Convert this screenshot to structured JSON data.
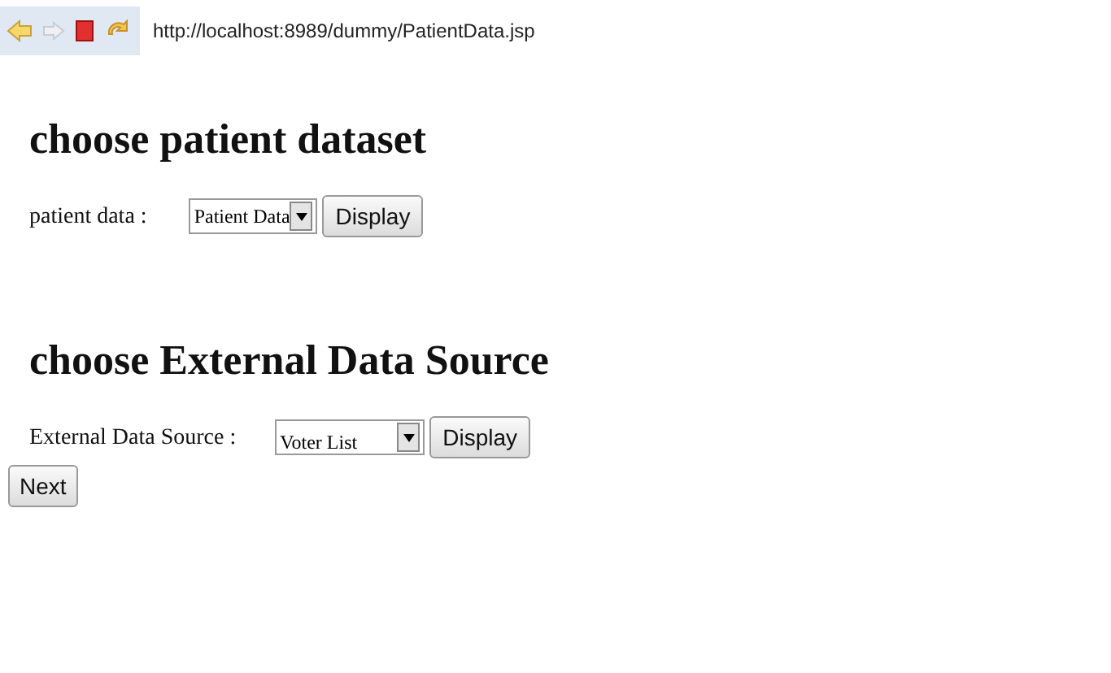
{
  "browser": {
    "address": "http://localhost:8989/dummy/PatientData.jsp"
  },
  "sections": [
    {
      "heading": "choose patient dataset",
      "label": "patient data :",
      "select_value": "Patient Data",
      "button": "Display"
    },
    {
      "heading": "choose External Data Source",
      "label": "External Data Source :",
      "select_value": "Voter List",
      "button": "Display"
    }
  ],
  "next_button": "Next"
}
